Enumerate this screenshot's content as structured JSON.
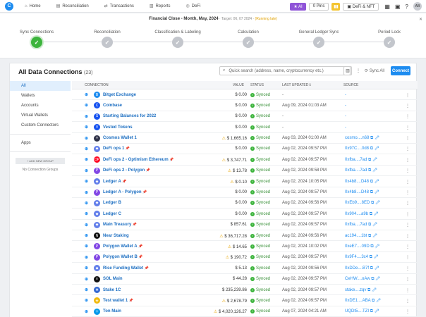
{
  "topbar": {
    "logo": "C",
    "nav": [
      {
        "icon": "home-icon",
        "glyph": "⌂",
        "label": "Home"
      },
      {
        "icon": "reconciliation-icon",
        "glyph": "▤",
        "label": "Reconciliation"
      },
      {
        "icon": "transactions-icon",
        "glyph": "⇄",
        "label": "Transactions"
      },
      {
        "icon": "reports-icon",
        "glyph": "▥",
        "label": "Reports"
      },
      {
        "icon": "defi-icon",
        "glyph": "◎",
        "label": "DeFi"
      }
    ],
    "ai_label": "★ AI",
    "pins_label": "0 Pins",
    "chart_glyph": "▮▮",
    "defi_nft_label": "▣ DeFi & NFT",
    "grid_glyph": "▦",
    "user_glyph": "▣",
    "help_glyph": "?",
    "avatar": "AB"
  },
  "financial_close": {
    "title": "Financial Close - Month, May, 2024",
    "target": " · Target: 06, 07 2024 · ",
    "status": "(Running late)",
    "close": "✕",
    "steps": [
      {
        "label": "Sync Connections",
        "active": true
      },
      {
        "label": "Reconciliation",
        "active": false
      },
      {
        "label": "Classification & Labeling",
        "active": false
      },
      {
        "label": "Calculation",
        "active": false
      },
      {
        "label": "General Ledger Sync",
        "active": false
      },
      {
        "label": "Period Lock",
        "active": false
      }
    ],
    "check_glyph": "✓"
  },
  "panel": {
    "title": "All Data Connections",
    "count": "(23)",
    "search_placeholder": "Quick search (address, name, cryptocurrency etc.)",
    "sync_all": "⟳ Sync All",
    "connect": "Connect",
    "columns_glyph": "▥",
    "kebab_glyph": "⋮"
  },
  "sidebar": {
    "items": [
      "All",
      "Wallets",
      "Accounts",
      "Virtual Wallets",
      "Custom Connectors"
    ],
    "apps": "Apps",
    "add_group": "+ ADD NEW GROUP",
    "no_groups": "No Connection Groups"
  },
  "table": {
    "headers": {
      "connection": "CONNECTION",
      "value": "VALUE",
      "status": "STATUS",
      "last_updated": "LAST UPDATED ℹ",
      "source": "SOURCE"
    },
    "rows": [
      {
        "name": "Bitget Exchange",
        "pin": "",
        "warn": false,
        "value": "$ 0.00",
        "status": "Synced",
        "updated": "-",
        "source": "-",
        "color": "#1d8cf0",
        "glyph": "B"
      },
      {
        "name": "Coinbase",
        "pin": "",
        "warn": false,
        "value": "$ 0.00",
        "status": "Synced",
        "updated": "Aug 09, 2024 01:03 AM",
        "source": "-",
        "color": "#1652f0",
        "glyph": "C"
      },
      {
        "name": "Starting Balances for 2022",
        "pin": "",
        "warn": false,
        "value": "$ 0.00",
        "status": "Synced",
        "updated": "-",
        "source": "-",
        "color": "#1652f0",
        "glyph": "S"
      },
      {
        "name": "Vested Tokens",
        "pin": "",
        "warn": false,
        "value": "$ 0.00",
        "status": "Synced",
        "updated": "-",
        "source": "-",
        "color": "#1652f0",
        "glyph": "V"
      },
      {
        "name": "Cosmos Wallet 1",
        "pin": "",
        "warn": true,
        "value": "$ 1,665.16",
        "status": "Synced",
        "updated": "Aug 03, 2024 01:00 AM",
        "source": "cosmo....n68 ⧉ ⇗",
        "color": "#2e3148",
        "glyph": "⚛"
      },
      {
        "name": "DeFi ops 1",
        "pin": " 📌",
        "warn": false,
        "value": "$ 0.00",
        "status": "Synced",
        "updated": "Aug 02, 2024 09:57 PM",
        "source": "0x97C....0d8 ⧉ ⇗",
        "color": "#627eea",
        "glyph": "◆"
      },
      {
        "name": "DeFi ops 2 - Optimism Ethereum",
        "pin": " 📌",
        "warn": true,
        "value": "$ 3,747.71",
        "status": "Synced",
        "updated": "Aug 02, 2024 09:57 PM",
        "source": "0xfba....7ad ⧉ ⇗",
        "color": "#ff0420",
        "glyph": "OP"
      },
      {
        "name": "DeFi ops 2 - Polygon",
        "pin": " 📌",
        "warn": true,
        "value": "$ 13.78",
        "status": "Synced",
        "updated": "Aug 02, 2024 09:58 PM",
        "source": "0xfba....7ad ⧉ ⇗",
        "color": "#8247e5",
        "glyph": "P"
      },
      {
        "name": "Ledger A",
        "pin": " 📌",
        "warn": true,
        "value": "$ 0.10",
        "status": "Synced",
        "updated": "Aug 02, 2024 10:05 PM",
        "source": "0x4b8....D48 ⧉ ⇗",
        "color": "#627eea",
        "glyph": "◆"
      },
      {
        "name": "Ledger A - Polygon",
        "pin": " 📌",
        "warn": false,
        "value": "$ 0.00",
        "status": "Synced",
        "updated": "Aug 02, 2024 09:57 PM",
        "source": "0x4b8....D48 ⧉ ⇗",
        "color": "#8247e5",
        "glyph": "P"
      },
      {
        "name": "Ledger B",
        "pin": "",
        "warn": false,
        "value": "$ 0.00",
        "status": "Synced",
        "updated": "Aug 02, 2024 09:56 PM",
        "source": "0xEb9....8ED ⧉ ⇗",
        "color": "#627eea",
        "glyph": "◆"
      },
      {
        "name": "Ledger C",
        "pin": "",
        "warn": false,
        "value": "$ 0.00",
        "status": "Synced",
        "updated": "Aug 02, 2024 09:57 PM",
        "source": "0x904....a9b ⧉ ⇗",
        "color": "#627eea",
        "glyph": "◆"
      },
      {
        "name": "Main Treasury",
        "pin": " 📌",
        "warn": false,
        "value": "$ 857.61",
        "status": "Synced",
        "updated": "Aug 02, 2024 09:57 PM",
        "source": "0xfba....7ad ⧉ ⇗",
        "color": "#627eea",
        "glyph": "◆"
      },
      {
        "name": "Near Staking",
        "pin": "",
        "warn": true,
        "value": "$ 36,717.28",
        "status": "Synced",
        "updated": "Aug 02, 2024 09:56 PM",
        "source": "ac194....1bt ⧉ ⇗",
        "color": "#111111",
        "glyph": "N"
      },
      {
        "name": "Polygon Wallet A",
        "pin": " 📌",
        "warn": true,
        "value": "$ 14.65",
        "status": "Synced",
        "updated": "Aug 02, 2024 10:02 PM",
        "source": "0xeE7....09D ⧉ ⇗",
        "color": "#8247e5",
        "glyph": "P"
      },
      {
        "name": "Polygon Wallet B",
        "pin": " 📌",
        "warn": true,
        "value": "$ 190.72",
        "status": "Synced",
        "updated": "Aug 02, 2024 09:57 PM",
        "source": "0x9F4....3c4 ⧉ ⇗",
        "color": "#8247e5",
        "glyph": "P"
      },
      {
        "name": "Rise Funding Wallet",
        "pin": " 📌",
        "warn": false,
        "value": "$ 5.13",
        "status": "Synced",
        "updated": "Aug 02, 2024 09:56 PM",
        "source": "0xDDe....B7f ⧉ ⇗",
        "color": "#627eea",
        "glyph": "◆"
      },
      {
        "name": "SOL Main",
        "pin": "",
        "warn": false,
        "value": "$ 44.28",
        "status": "Synced",
        "updated": "Aug 02, 2024 09:57 PM",
        "source": "CeHW....oAw ⧉ ⇗",
        "color": "#111111",
        "glyph": "≡"
      },
      {
        "name": "Stake 1C",
        "pin": "",
        "warn": false,
        "value": "$ 235,239.86",
        "status": "Synced",
        "updated": "Aug 02, 2024 09:57 PM",
        "source": "stake....zqv ⧉ ⇗",
        "color": "#3468d1",
        "glyph": "₳"
      },
      {
        "name": "Test wallet 1",
        "pin": " 📌",
        "warn": true,
        "value": "$ 2,678.79",
        "status": "Synced",
        "updated": "Aug 02, 2024 09:57 PM",
        "source": "0xDE1....ABA ⧉ ⇗",
        "color": "#f0b90b",
        "glyph": "◈"
      },
      {
        "name": "Ton Main",
        "pin": "",
        "warn": true,
        "value": "$ 4,020,126.27",
        "status": "Synced",
        "updated": "Aug 07, 2024 04:21 AM",
        "source": "UQDt5....TZI ⧉ ⇗",
        "color": "#0098ea",
        "glyph": "◇"
      }
    ]
  }
}
